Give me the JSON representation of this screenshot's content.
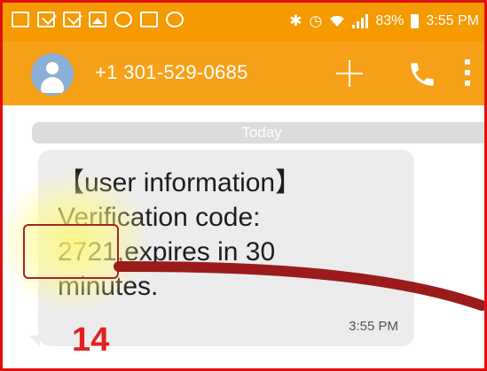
{
  "status_bar": {
    "battery": "83%",
    "time": "3:55 PM"
  },
  "app_bar": {
    "contact": "+1 301-529-0685",
    "icons": [
      "add-icon",
      "phone-icon",
      "more-vert-icon"
    ]
  },
  "thread": {
    "date_label": "Today",
    "message": {
      "text": "【user information】\nVerification code:\n2721,expires in 30\nminutes.",
      "time": "3:55 PM"
    }
  },
  "annotation": {
    "step": "14",
    "color": "#e52020"
  },
  "colors": {
    "status_bar": "#f59a00",
    "app_bar": "#f7a118",
    "bubble": "#ececec",
    "arrow": "#9b1b1b"
  }
}
